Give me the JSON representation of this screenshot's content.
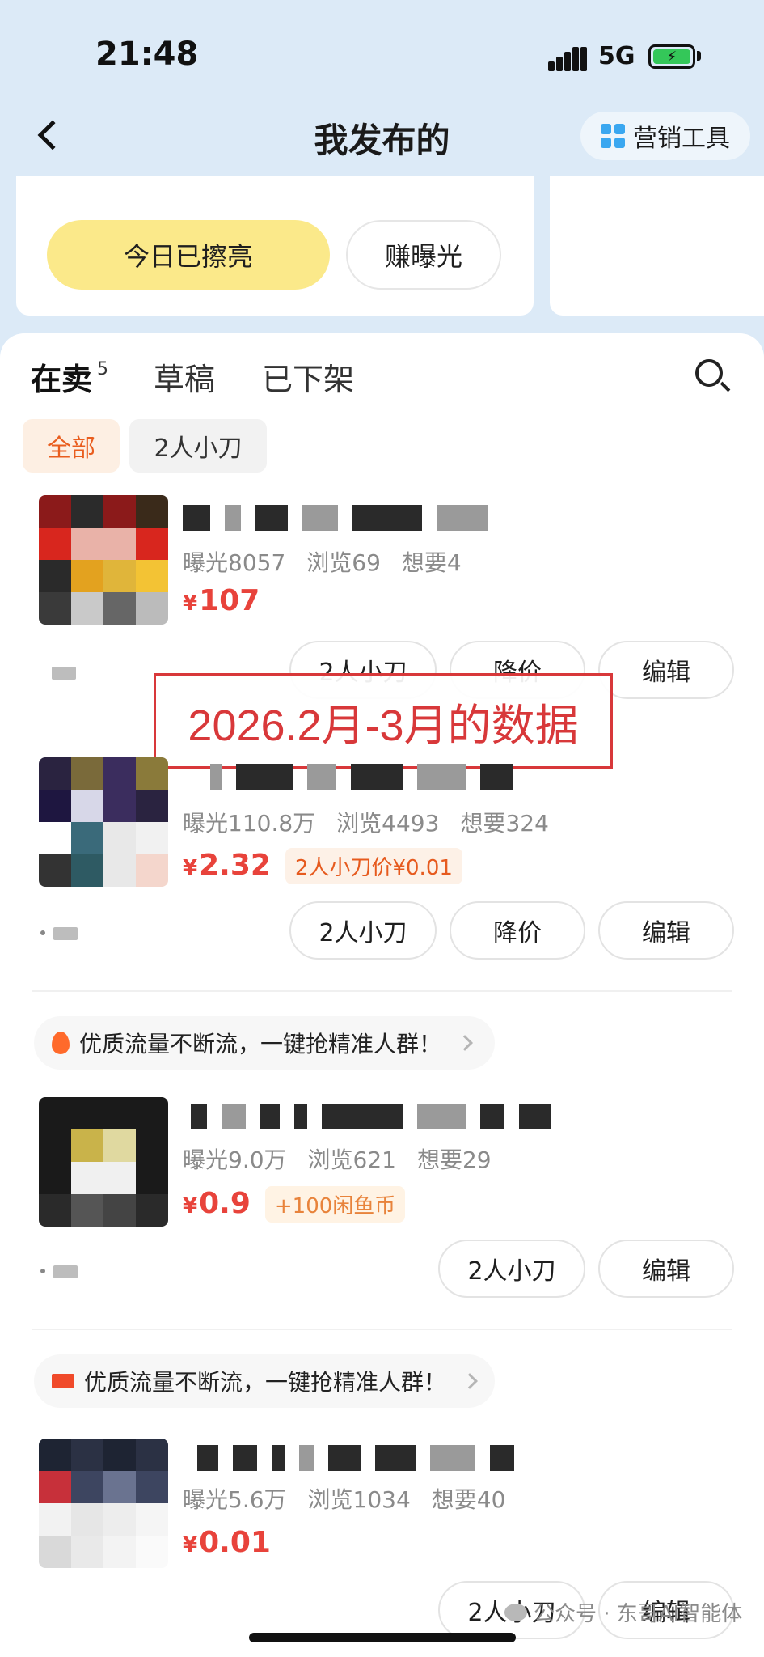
{
  "status": {
    "time": "21:48",
    "network": "5G"
  },
  "nav": {
    "title": "我发布的",
    "tools_label": "营销工具"
  },
  "top_card": {
    "polish_label": "今日已擦亮",
    "exposure_label": "赚曝光"
  },
  "tabs": [
    {
      "label": "在卖",
      "count": "5"
    },
    {
      "label": "草稿"
    },
    {
      "label": "已下架"
    }
  ],
  "filters": [
    {
      "label": "全部"
    },
    {
      "label": "2人小刀"
    }
  ],
  "annotation": "2026.2月-3月的数据",
  "promo_text": "优质流量不断流，一键抢精准人群！",
  "products": [
    {
      "exposure": "曝光8057",
      "views": "浏览69",
      "wants": "想要4",
      "currency": "¥",
      "price": "107",
      "tag": "",
      "actions": [
        "2人小刀",
        "降价",
        "编辑"
      ]
    },
    {
      "exposure": "曝光110.8万",
      "views": "浏览4493",
      "wants": "想要324",
      "currency": "¥",
      "price": "2.32",
      "tag": "2人小刀价¥0.01",
      "actions": [
        "2人小刀",
        "降价",
        "编辑"
      ]
    },
    {
      "exposure": "曝光9.0万",
      "views": "浏览621",
      "wants": "想要29",
      "currency": "¥",
      "price": "0.9",
      "tag": "+100闲鱼币",
      "actions": [
        "2人小刀",
        "编辑"
      ]
    },
    {
      "exposure": "曝光5.6万",
      "views": "浏览1034",
      "wants": "想要40",
      "currency": "¥",
      "price": "0.01",
      "tag": "",
      "actions": [
        "2人小刀",
        "编辑"
      ]
    }
  ],
  "watermark": "公众号 · 东哥AI智能体"
}
